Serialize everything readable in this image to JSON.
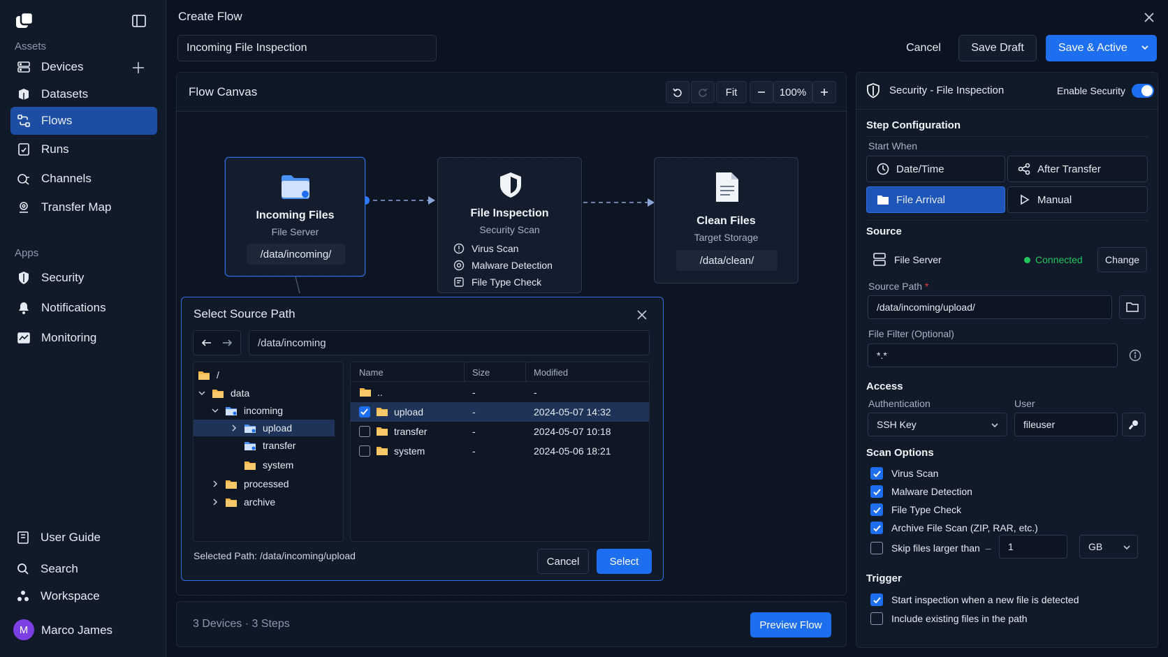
{
  "sidebar": {
    "sections": {
      "assets": "Assets",
      "apps": "Apps"
    },
    "items": [
      {
        "label": "Devices",
        "icon": "server-icon"
      },
      {
        "label": "Datasets",
        "icon": "dataset-icon"
      },
      {
        "label": "Flows",
        "icon": "flows-icon",
        "active": true
      },
      {
        "label": "Runs",
        "icon": "runs-icon"
      },
      {
        "label": "Channels",
        "icon": "channels-icon"
      },
      {
        "label": "Transfer Map",
        "icon": "map-pin-icon"
      }
    ],
    "apps": [
      {
        "label": "Security",
        "icon": "shield-icon"
      },
      {
        "label": "Notifications",
        "icon": "bell-icon"
      },
      {
        "label": "Monitoring",
        "icon": "monitor-icon"
      }
    ],
    "bottom": [
      {
        "label": "User Guide",
        "icon": "book-icon"
      },
      {
        "label": "Search",
        "icon": "search-icon"
      },
      {
        "label": "Workspace",
        "icon": "workspace-icon"
      }
    ],
    "user": {
      "initial": "M",
      "name": "Marco James"
    }
  },
  "header": {
    "title": "Create Flow",
    "flow_name": "Incoming File Inspection",
    "cancel": "Cancel",
    "save_draft": "Save Draft",
    "save_active": "Save & Active"
  },
  "canvas": {
    "title": "Flow Canvas",
    "fit": "Fit",
    "zoom": "100%",
    "nodes": {
      "incoming": {
        "title": "Incoming Files",
        "subtitle": "File Server",
        "path": "/data/incoming/"
      },
      "inspection": {
        "title": "File Inspection",
        "subtitle": "Security Scan",
        "checks": [
          "Virus Scan",
          "Malware Detection",
          "File Type Check"
        ]
      },
      "clean": {
        "title": "Clean Files",
        "subtitle": "Target Storage",
        "path": "/data/clean/"
      }
    }
  },
  "modal": {
    "title": "Select Source Path",
    "path": "/data/incoming",
    "tree": [
      "/",
      "data",
      "incoming",
      "upload",
      "transfer",
      "system",
      "processed",
      "archive"
    ],
    "columns": [
      "Name",
      "Size",
      "Modified"
    ],
    "rows": [
      {
        "name": "..",
        "size": "-",
        "modified": "-"
      },
      {
        "name": "upload",
        "size": "-",
        "modified": "2024-05-07 14:32",
        "checked": true
      },
      {
        "name": "transfer",
        "size": "-",
        "modified": "2024-05-07 10:18"
      },
      {
        "name": "system",
        "size": "-",
        "modified": "2024-05-06 18:21"
      }
    ],
    "selected_path": "Selected Path: /data/incoming/upload",
    "cancel": "Cancel",
    "select": "Select"
  },
  "footer": {
    "summary": "3 Devices · 3 Steps",
    "preview": "Preview Flow"
  },
  "panel": {
    "title": "Security - File Inspection",
    "enable_label": "Enable Security",
    "enabled": true,
    "step_config": "Step Configuration",
    "start_when": "Start When",
    "triggers": [
      "Date/Time",
      "After Transfer",
      "File Arrival",
      "Manual"
    ],
    "source_heading": "Source",
    "source_device": "File Server",
    "status": "Connected",
    "change": "Change",
    "source_path_label": "Source Path",
    "required_mark": "*",
    "source_path": "/data/incoming/upload/",
    "filter_label": "File Filter (Optional)",
    "filter": "*.*",
    "access": "Access",
    "auth_label": "Authentication",
    "auth_value": "SSH Key",
    "user_label": "User",
    "user_value": "fileuser",
    "scan_options": "Scan Options",
    "options": [
      "Virus Scan",
      "Malware Detection",
      "File Type Check",
      "Archive File Scan (ZIP, RAR, etc.)"
    ],
    "skip_label": "Skip files larger than",
    "skip_dash": "–",
    "skip_value": "1",
    "skip_unit": "GB",
    "trigger": "Trigger",
    "trigger_new": "Start inspection when a new file is detected",
    "trigger_existing": "Include existing files in the path"
  },
  "colors": {
    "accent": "#1d6ff0",
    "connected": "#22c55e",
    "background": "#0b1220"
  }
}
